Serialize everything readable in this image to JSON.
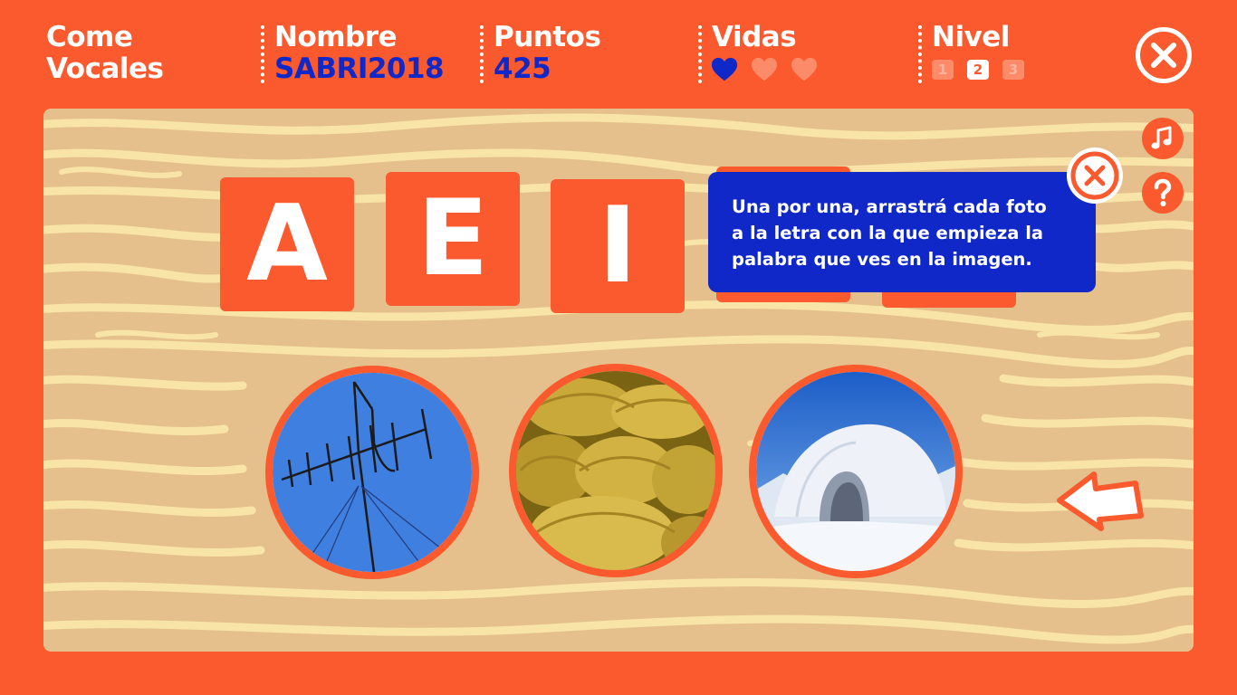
{
  "header": {
    "title_line1": "Come",
    "title_line2": "Vocales",
    "name_label": "Nombre",
    "name_value": "SABRI2018",
    "points_label": "Puntos",
    "points_value": "425",
    "lives_label": "Vidas",
    "lives_total": 3,
    "lives_remaining": 1,
    "level_label": "Nivel",
    "levels": [
      "1",
      "2",
      "3"
    ],
    "current_level": "2"
  },
  "letters": [
    "A",
    "E",
    "I"
  ],
  "tooltip": {
    "line1": "Una por una, arrastrá cada foto",
    "line2": "a la letra con la que empieza la",
    "line3": "palabra que ves en la imagen."
  },
  "photos": [
    {
      "icon": "antenna-photo"
    },
    {
      "icon": "empanadas-photo"
    },
    {
      "icon": "igloo-photo"
    }
  ],
  "icons": {
    "close": "close-icon",
    "music": "music-note-icon",
    "help": "question-icon",
    "next": "arrow-left-icon"
  },
  "colors": {
    "orange": "#fa5a2d",
    "blue": "#1128c8",
    "wood": "#e5c08c",
    "grain": "#f8e4a6",
    "white": "#ffffff"
  }
}
